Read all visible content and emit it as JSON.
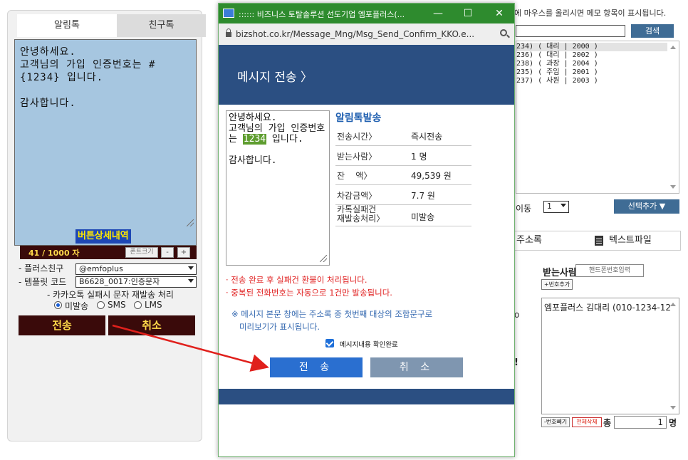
{
  "left_panel": {
    "tabs": [
      "알림톡",
      "친구톡"
    ],
    "message": "안녕하세요.\n고객님의 가입 인증번호는 #{1234} 입니다.\n\n감사합니다.",
    "detail_button": "버튼상세내역",
    "counter": "41 / 1000 자",
    "font_size_label": "폰트크기",
    "step_minus": "-",
    "step_plus": "+",
    "plus_friend_label": "- 플러스친구",
    "plus_friend_value": "@emfoplus",
    "template_label": "- 템플릿 코드",
    "template_value": "B6628_0017:인증문자",
    "resend_label": "- 카카오톡 실패시 문자 재발송 처리",
    "radio_options": [
      "미발송",
      "SMS",
      "LMS"
    ],
    "send_button": "전송",
    "cancel_button": "취소"
  },
  "right_panel": {
    "hint": "에 마우스를 올리시면 메모 항목이 표시됩니다.",
    "search_button": "검색",
    "list_rows": [
      "234) ( 대리 | 2000 )",
      "236) ( 대리 | 2002 )",
      "238) ( 과장 | 2004 )",
      "235) ( 주임 | 2001 )",
      "237) ( 사원 | 2003 )"
    ],
    "move_label": "이동",
    "move_value": "1",
    "add_selected_button": "선택추가 ▼",
    "tab_addressbook": "주소록",
    "tab_textfile": "텍스트파일",
    "receiver_label": "받는사람",
    "phone_placeholder": "핸드폰번호입력",
    "add_number_button": "+번호추가",
    "receiver_item": "엠포플러스  김대리 (010-1234-12",
    "delete_number_button": "-번호빼기",
    "delete_all_button": "전체삭제",
    "total_label": "총",
    "total_value": "1",
    "total_unit": "명",
    "edge_mark": "!",
    "edge_mark2": "o"
  },
  "popup": {
    "title": ":::::: 비즈니스 토탈솔루션 선도기업 엠포플러스(...",
    "minimize": "—",
    "maximize": "☐",
    "close": "✕",
    "url": "bizshot.co.kr/Message_Mng/Msg_Send_Confirm_KKO.e...",
    "header_title": "메시지 전송 〉",
    "preview_before": "안녕하세요.\n고객님의 가입 인증번호는 ",
    "preview_code": "1234",
    "preview_after": " 입니다.\n\n감사합니다.",
    "info_title": "알림톡발송",
    "info_rows": [
      {
        "key": "전송시간〉",
        "value": "즉시전송"
      },
      {
        "key": "받는사람〉",
        "value": "1 명"
      },
      {
        "key": "잔    액〉",
        "value": "49,539 원"
      },
      {
        "key": "차감금액〉",
        "value": "7.7 원"
      },
      {
        "key": "카톡실패건\n재발송처리〉",
        "value": "미발송"
      }
    ],
    "notice_lines": [
      "· 전송 완료 후 실패건 환불이 처리됩니다.",
      "· 중복된 전화번호는 자동으로 1건만 발송됩니다."
    ],
    "preview_note": "※ 메시지 본문 창에는 주소록 중 첫번째 대상의 조합문구로\n   미리보기가 표시됩니다.",
    "confirm_label": "메시지내용 확인완료",
    "send_button": "전 송",
    "cancel_button": "취 소"
  },
  "colors": {
    "titlebar": "#2e8b2e",
    "header": "#2b4f82",
    "msgbox": "#a6c6e0",
    "dark": "#3a0a0a",
    "accent_yellow": "#ffd94a",
    "send_blue": "#2a6fd0",
    "arrow": "#e0201c"
  }
}
